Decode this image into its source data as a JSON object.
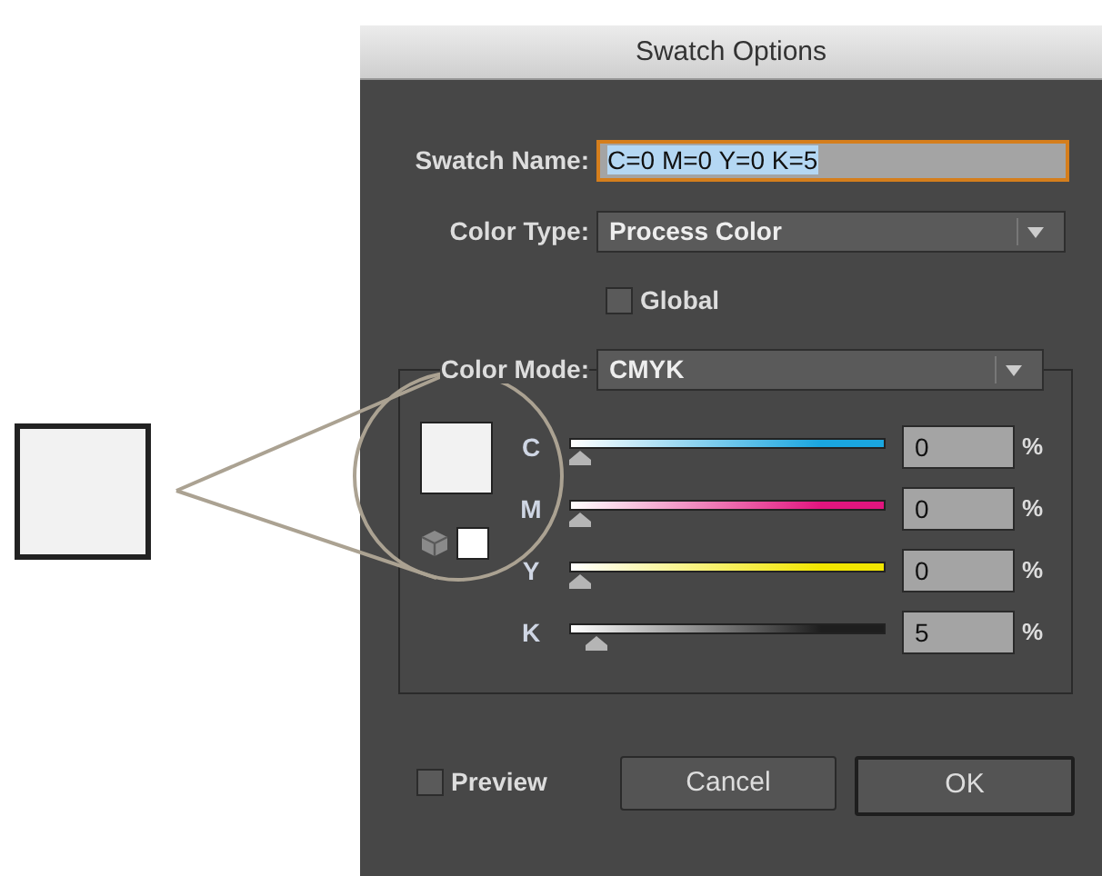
{
  "window": {
    "title": "Swatch Options"
  },
  "fields": [
    {
      "kind": "text",
      "label": "Swatch Name:",
      "value": "C=0 M=0 Y=0 K=5",
      "selected": true
    },
    {
      "kind": "select",
      "label": "Color Type:",
      "value": "Process Color"
    }
  ],
  "global": {
    "label": "Global",
    "checked": false
  },
  "color_mode": {
    "label": "Color Mode:",
    "value": "CMYK"
  },
  "channels": [
    {
      "name": "C",
      "level": 0,
      "reading": "0",
      "unit": "%",
      "color": "#1aa6df"
    },
    {
      "name": "M",
      "level": 0,
      "reading": "0",
      "unit": "%",
      "color": "#e2157f"
    },
    {
      "name": "Y",
      "level": 0,
      "reading": "0",
      "unit": "%",
      "color": "#f2e600"
    },
    {
      "name": "K",
      "level": 0.05,
      "reading": "5",
      "unit": "%",
      "color": "#1e1e1e"
    }
  ],
  "preview": {
    "label": "Preview",
    "checked": false
  },
  "buttons": [
    {
      "label": "Cancel",
      "default": false
    },
    {
      "label": "OK",
      "default": true
    }
  ]
}
